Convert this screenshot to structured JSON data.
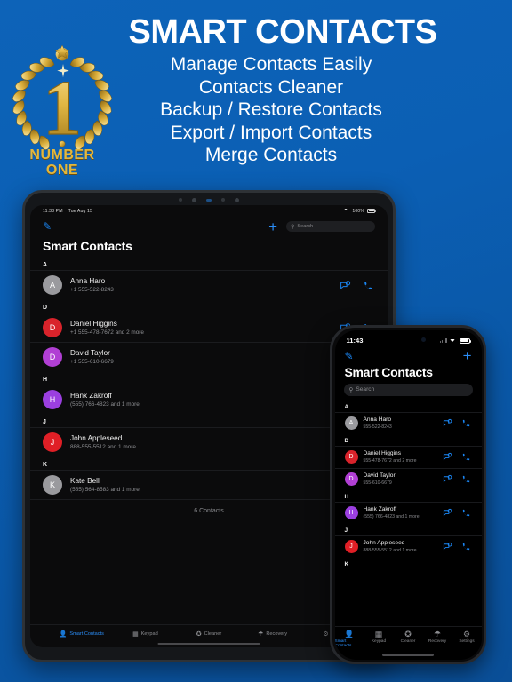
{
  "hero": {
    "title": "SMART CONTACTS",
    "lines": [
      "Manage Contacts Easily",
      "Contacts Cleaner",
      "Backup / Restore Contacts",
      "Export / Import Contacts",
      "Merge Contacts"
    ],
    "badge": {
      "number": "1",
      "line1": "NUMBER",
      "line2": "ONE"
    },
    "accent_blue": "#0b5fb4",
    "gold": "#e3b73d"
  },
  "tablet": {
    "status": {
      "time": "11:38 PM",
      "date": "Tue Aug 15",
      "battery": "100%"
    },
    "nav": {
      "edit_icon": "pencil-icon",
      "add_icon": "plus-icon"
    },
    "search": {
      "placeholder": "Search"
    },
    "title": "Smart Contacts",
    "sections": [
      {
        "letter": "A",
        "contacts": [
          {
            "name": "Anna Haro",
            "phone": "+1 555-522-8243",
            "initial": "A",
            "color": "#9a9a9e"
          }
        ]
      },
      {
        "letter": "D",
        "contacts": [
          {
            "name": "Daniel Higgins",
            "phone": "+1 555-478-7672 and 2 more",
            "initial": "D",
            "color": "#d9232b"
          },
          {
            "name": "David Taylor",
            "phone": "+1 555-610-6679",
            "initial": "D",
            "color": "#b13fd4"
          }
        ]
      },
      {
        "letter": "H",
        "contacts": [
          {
            "name": "Hank Zakroff",
            "phone": "(555) 766-4823 and 1 more",
            "initial": "H",
            "color": "#9b3fe0"
          }
        ]
      },
      {
        "letter": "J",
        "contacts": [
          {
            "name": "John Appleseed",
            "phone": "888-555-5512 and 1 more",
            "initial": "J",
            "color": "#e01f26"
          }
        ]
      },
      {
        "letter": "K",
        "contacts": [
          {
            "name": "Kate Bell",
            "phone": "(555) 564-8583 and 1 more",
            "initial": "K",
            "color": "#9a9a9e"
          }
        ]
      }
    ],
    "count_label": "6 Contacts",
    "tabs": [
      {
        "label": "Smart Contacts",
        "icon": "person-icon",
        "active": true
      },
      {
        "label": "Keypad",
        "icon": "grid-icon",
        "active": false
      },
      {
        "label": "Cleaner",
        "icon": "broom-icon",
        "active": false
      },
      {
        "label": "Recovery",
        "icon": "camera-icon",
        "active": false
      },
      {
        "label": "Settings",
        "icon": "gear-icon",
        "active": false
      }
    ]
  },
  "phone": {
    "status": {
      "time": "11:43"
    },
    "nav": {
      "edit_icon": "pencil-icon",
      "add_icon": "plus-icon"
    },
    "search": {
      "placeholder": "Search"
    },
    "title": "Smart Contacts",
    "sections": [
      {
        "letter": "A",
        "contacts": [
          {
            "name": "Anna Haro",
            "phone": "555-522-8243",
            "initial": "A",
            "color": "#9a9a9e"
          }
        ]
      },
      {
        "letter": "D",
        "contacts": [
          {
            "name": "Daniel Higgins",
            "phone": "555-478-7672 and 2 more",
            "initial": "D",
            "color": "#d9232b"
          },
          {
            "name": "David Taylor",
            "phone": "555-610-6679",
            "initial": "D",
            "color": "#b13fd4"
          }
        ]
      },
      {
        "letter": "H",
        "contacts": [
          {
            "name": "Hank Zakroff",
            "phone": "(555) 766-4823 and 1 more",
            "initial": "H",
            "color": "#9b3fe0"
          }
        ]
      },
      {
        "letter": "J",
        "contacts": [
          {
            "name": "John Appleseed",
            "phone": "888-555-5512 and 1 more",
            "initial": "J",
            "color": "#e01f26"
          }
        ]
      },
      {
        "letter": "K",
        "contacts": []
      }
    ],
    "tabs": [
      {
        "label": "Smart Contacts",
        "icon": "person-icon",
        "active": true
      },
      {
        "label": "Keypad",
        "icon": "grid-icon",
        "active": false
      },
      {
        "label": "Cleaner",
        "icon": "broom-icon",
        "active": false
      },
      {
        "label": "Recovery",
        "icon": "camera-icon",
        "active": false
      },
      {
        "label": "Settings",
        "icon": "gear-icon",
        "active": false
      }
    ]
  }
}
